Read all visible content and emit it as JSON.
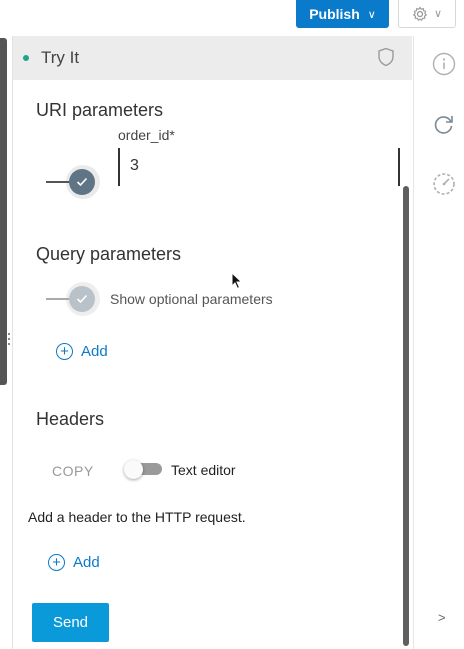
{
  "toolbar": {
    "publish_label": "Publish",
    "publish_chevron": "∨"
  },
  "settings": {
    "icon": "gear-icon",
    "chevron": "∨"
  },
  "panel": {
    "title": "Try It",
    "status_color": "#19a689"
  },
  "uri_params": {
    "title": "URI parameters",
    "field_label": "order_id*",
    "field_value": "3",
    "toggle_on": true
  },
  "query_params": {
    "title": "Query parameters",
    "toggle_label": "Show optional parameters",
    "toggle_on": true,
    "add_label": "Add"
  },
  "headers": {
    "title": "Headers",
    "copy_label": "COPY",
    "text_editor_label": "Text editor",
    "text_editor_on": false,
    "hint": "Add a header to the HTTP request.",
    "add_label": "Add"
  },
  "send_label": "Send",
  "rail": {
    "expand_label": ">"
  },
  "colors": {
    "accent": "#0a7acb",
    "send": "#0a9ad9",
    "status": "#19a689"
  }
}
